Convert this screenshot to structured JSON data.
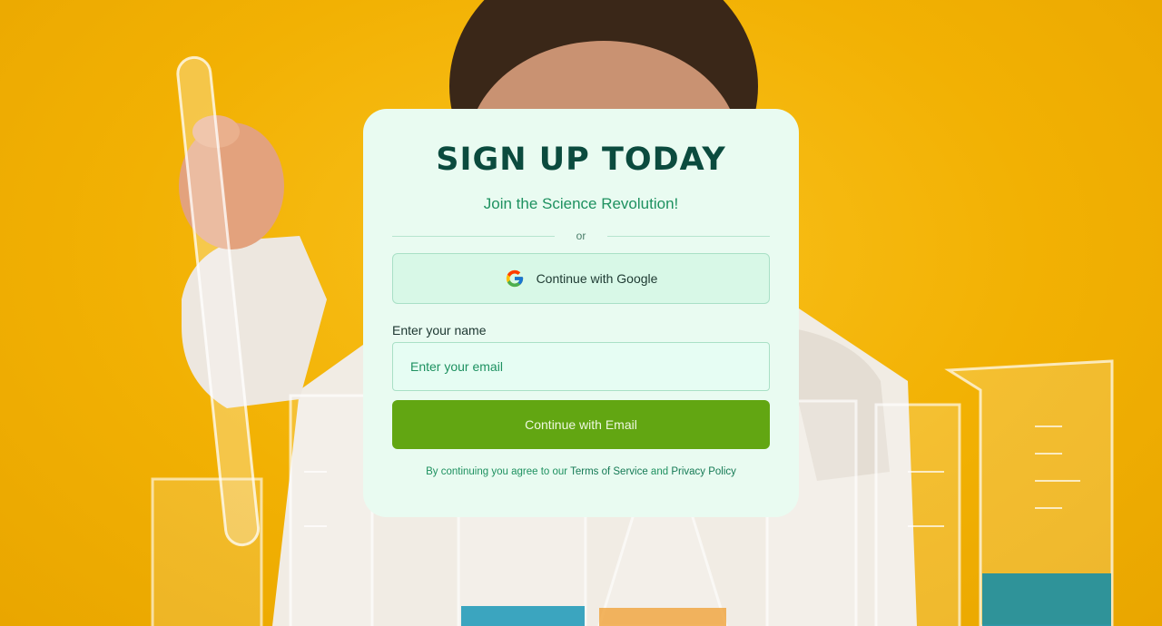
{
  "signup": {
    "title": "SIGN UP TODAY",
    "subtitle": "Join the Science Revolution!",
    "divider_text": "or",
    "google_button_label": "Continue with Google",
    "name_label": "Enter your name",
    "email_placeholder": "Enter your email",
    "email_value": "",
    "email_button_label": "Continue with Email",
    "terms": {
      "prefix": "By continuing you agree to our ",
      "tos_link": "Terms of Service",
      "and": " and ",
      "privacy_link": "Privacy Policy"
    }
  },
  "icons": {
    "google": "google-g-icon"
  },
  "colors": {
    "background_yellow": "#f2b103",
    "card_background": "#e9fbf1",
    "title": "#0b4b3e",
    "accent_green": "#1e9160",
    "primary_button": "#62a612"
  }
}
